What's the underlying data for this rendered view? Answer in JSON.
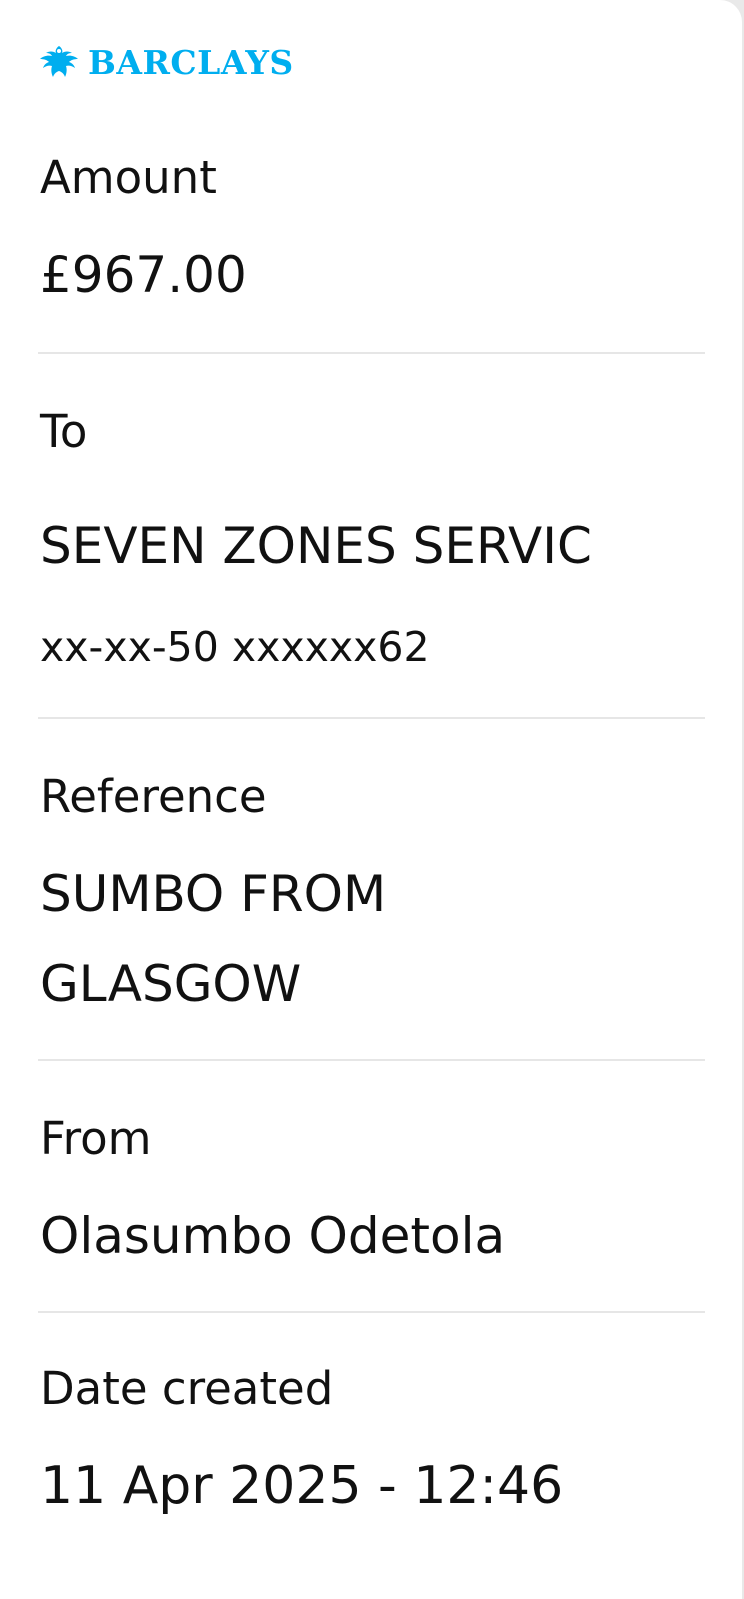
{
  "brand": {
    "name": "BARCLAYS",
    "logo_icon": "eagle-icon",
    "color": "#00aeef"
  },
  "fields": {
    "amount": {
      "label": "Amount",
      "value": "£967.00"
    },
    "to": {
      "label": "To",
      "value": "SEVEN ZONES SERVIC",
      "account": "xx-xx-50 xxxxxx62"
    },
    "reference": {
      "label": "Reference",
      "line1": "SUMBO FROM",
      "line2": "GLASGOW"
    },
    "from": {
      "label": "From",
      "value": "Olasumbo Odetola"
    },
    "date_created": {
      "label": "Date created",
      "value": "11 Apr 2025 - 12:46"
    }
  }
}
